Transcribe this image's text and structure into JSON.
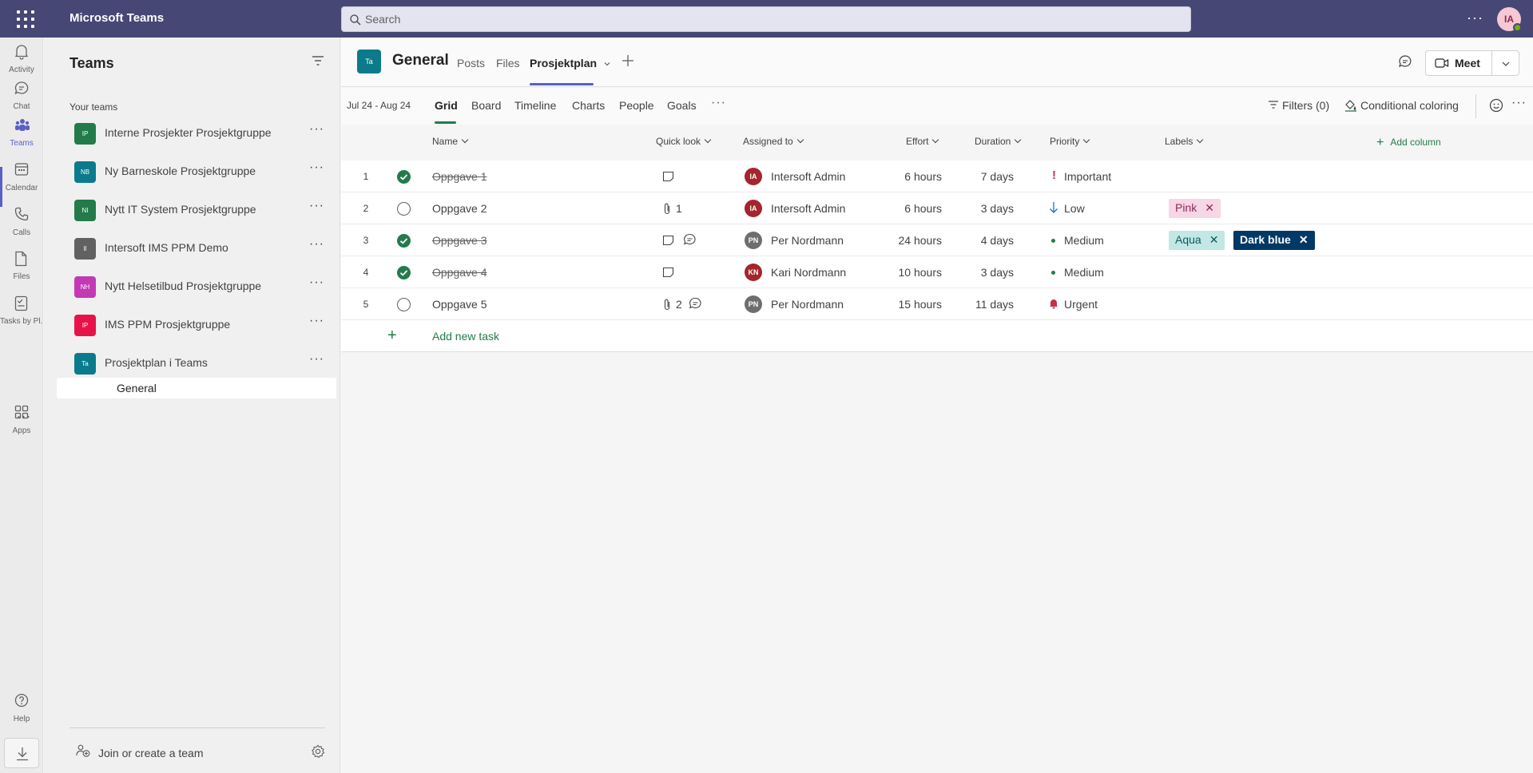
{
  "app": {
    "title": "Microsoft Teams",
    "user_initials": "IA"
  },
  "search": {
    "placeholder": "Search"
  },
  "rail": {
    "items": [
      {
        "label": "Activity",
        "icon": "bell-icon"
      },
      {
        "label": "Chat",
        "icon": "chat-icon"
      },
      {
        "label": "Teams",
        "icon": "teams-icon"
      },
      {
        "label": "Calendar",
        "icon": "calendar-icon"
      },
      {
        "label": "Calls",
        "icon": "phone-icon"
      },
      {
        "label": "Files",
        "icon": "file-icon"
      },
      {
        "label": "Tasks by Pl...",
        "icon": "tasks-icon"
      },
      {
        "label": "Apps",
        "icon": "apps-icon"
      },
      {
        "label": "Help",
        "icon": "help-icon"
      }
    ],
    "more": "..."
  },
  "teams_panel": {
    "title": "Teams",
    "section": "Your teams",
    "teams": [
      {
        "initials": "IP",
        "name": "Interne Prosjekter Prosjektgruppe",
        "color": "#237b4b"
      },
      {
        "initials": "NB",
        "name": "Ny Barneskole Prosjektgruppe",
        "color": "#0b7b8b"
      },
      {
        "initials": "NI",
        "name": "Nytt IT System Prosjektgruppe",
        "color": "#237b4b"
      },
      {
        "initials": "II",
        "name": "Intersoft IMS PPM Demo",
        "color": "#616161"
      },
      {
        "initials": "NH",
        "name": "Nytt Helsetilbud Prosjektgruppe",
        "color": "#c239b3"
      },
      {
        "initials": "IP",
        "name": "IMS PPM Prosjektgruppe",
        "color": "#e8124a"
      },
      {
        "initials": "Ta",
        "name": "Prosjektplan i Teams",
        "color": "#0b7b8b"
      }
    ],
    "channel": "General",
    "join": "Join or create a team"
  },
  "header": {
    "tile": "Ta",
    "channel": "General",
    "tabs": [
      "Posts",
      "Files",
      "Prosjektplan"
    ],
    "meet": "Meet"
  },
  "toolbar": {
    "date_range": "Jul 24 - Aug 24",
    "views": [
      "Grid",
      "Board",
      "Timeline",
      "Charts",
      "People",
      "Goals"
    ],
    "filters": "Filters (0)",
    "conditional": "Conditional coloring"
  },
  "grid": {
    "columns": [
      "Name",
      "Quick look",
      "Assigned to",
      "Effort",
      "Duration",
      "Priority",
      "Labels"
    ],
    "add_column": "Add column",
    "add_task": "Add new task",
    "rows": [
      {
        "num": "1",
        "name": "Oppgave 1",
        "done": true,
        "attach": "",
        "note": true,
        "comment": false,
        "assignee_initials": "IA",
        "assignee": "Intersoft Admin",
        "assignee_color": "#a4262c",
        "effort": "6 hours",
        "duration": "7 days",
        "priority": "Important",
        "priority_icon": "exclamation-icon",
        "labels": []
      },
      {
        "num": "2",
        "name": "Oppgave 2",
        "done": false,
        "attach": "1",
        "note": false,
        "comment": false,
        "assignee_initials": "IA",
        "assignee": "Intersoft Admin",
        "assignee_color": "#a4262c",
        "effort": "6 hours",
        "duration": "3 days",
        "priority": "Low",
        "priority_icon": "arrow-down-icon",
        "labels": [
          {
            "text": "Pink",
            "bg": "#f7d6e6",
            "fg": "#8a2a5a"
          }
        ]
      },
      {
        "num": "3",
        "name": "Oppgave 3",
        "done": true,
        "attach": "",
        "note": true,
        "comment": true,
        "assignee_initials": "PN",
        "assignee": "Per Nordmann",
        "assignee_color": "#6e6e6e",
        "effort": "24 hours",
        "duration": "4 days",
        "priority": "Medium",
        "priority_icon": "dot-icon",
        "labels": [
          {
            "text": "Aqua",
            "bg": "#c2e7e5",
            "fg": "#0b5a5a"
          },
          {
            "text": "Dark blue",
            "bg": "#003966",
            "fg": "#ffffff"
          }
        ]
      },
      {
        "num": "4",
        "name": "Oppgave 4",
        "done": true,
        "attach": "",
        "note": true,
        "comment": false,
        "assignee_initials": "KN",
        "assignee": "Kari Nordmann",
        "assignee_color": "#a4262c",
        "effort": "10 hours",
        "duration": "3 days",
        "priority": "Medium",
        "priority_icon": "dot-icon",
        "labels": []
      },
      {
        "num": "5",
        "name": "Oppgave 5",
        "done": false,
        "attach": "2",
        "note": false,
        "comment": true,
        "assignee_initials": "PN",
        "assignee": "Per Nordmann",
        "assignee_color": "#6e6e6e",
        "effort": "15 hours",
        "duration": "11 days",
        "priority": "Urgent",
        "priority_icon": "bell-urgent-icon",
        "labels": []
      }
    ]
  }
}
